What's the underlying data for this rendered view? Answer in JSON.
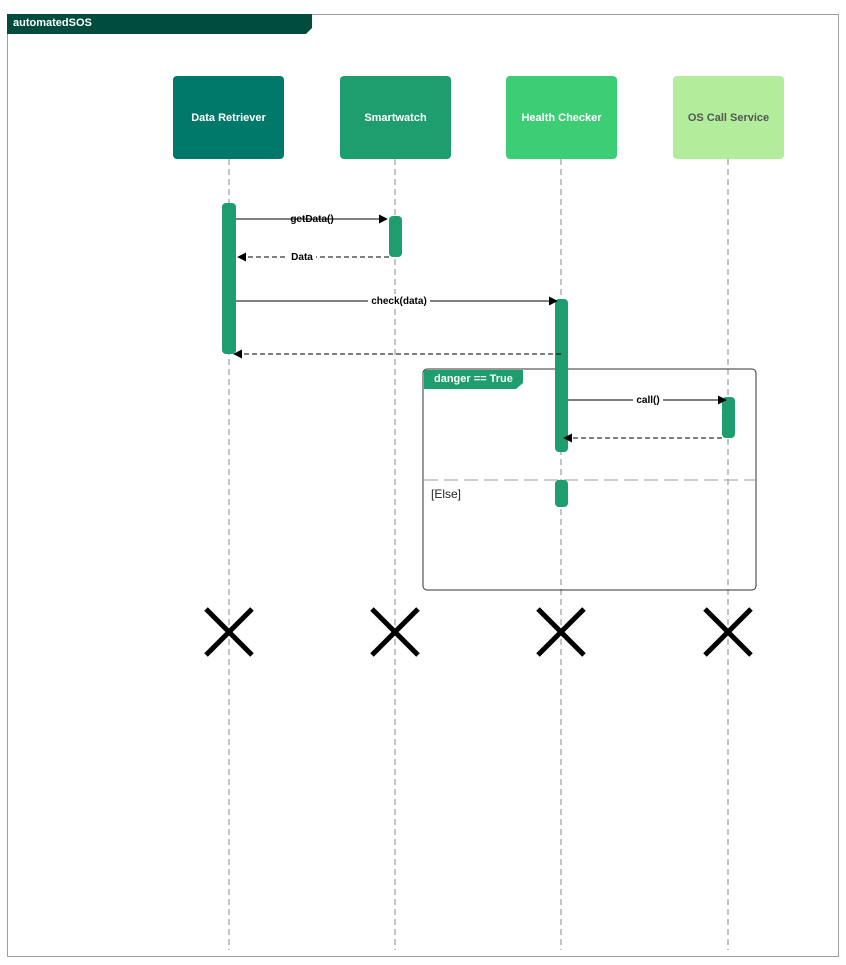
{
  "diagram": {
    "frame_title": "automatedSOS",
    "participants": [
      {
        "label": "Data Retriever",
        "fill": "#00796b",
        "text_color": "#ffffff"
      },
      {
        "label": "Smartwatch",
        "fill": "#1e9e6e",
        "text_color": "#ffffff"
      },
      {
        "label": "Health Checker",
        "fill": "#3ccd75",
        "text_color": "#ffffff"
      },
      {
        "label": "OS Call Service",
        "fill": "#b2ed9c",
        "text_color": "#555555"
      }
    ],
    "messages": [
      {
        "label": "getData()",
        "from": "Data Retriever",
        "to": "Smartwatch",
        "style": "solid"
      },
      {
        "label": "Data",
        "from": "Smartwatch",
        "to": "Data Retriever",
        "style": "dashed"
      },
      {
        "label": "check(data)",
        "from": "Data Retriever",
        "to": "Health Checker",
        "style": "solid"
      },
      {
        "label": "",
        "from": "Health Checker",
        "to": "Data Retriever",
        "style": "dashed"
      },
      {
        "label": "call()",
        "from": "Health Checker",
        "to": "OS Call Service",
        "style": "solid"
      },
      {
        "label": "",
        "from": "OS Call Service",
        "to": "Health Checker",
        "style": "dashed"
      }
    ],
    "fragment": {
      "condition": "danger == True",
      "else_label": "[Else]"
    },
    "colors": {
      "frame_tab": "#004d40",
      "activation": "#1e9e6e",
      "fragment_tab": "#1e9e6e",
      "lifeline": "#8a8a8a",
      "destroy_mark": "#000000"
    }
  }
}
